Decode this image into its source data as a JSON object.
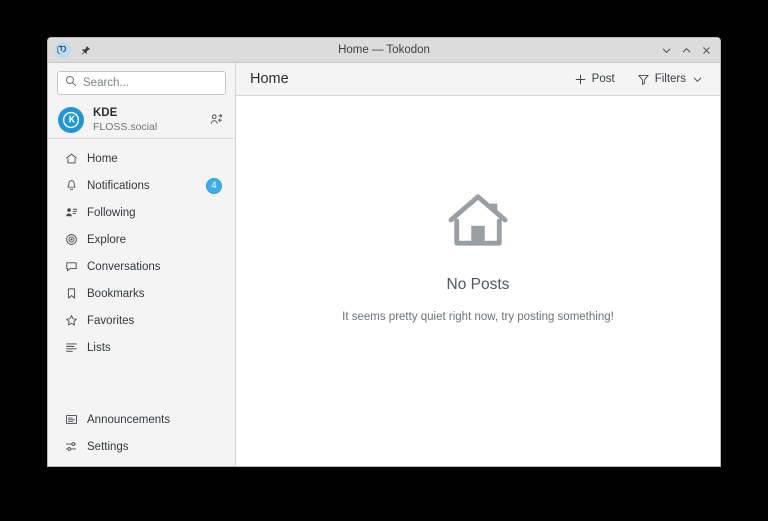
{
  "window": {
    "title": "Home — Tokodon",
    "app_icon": "mastodon-icon",
    "pin_icon": "pin-icon",
    "controls": [
      {
        "name": "minimize-button",
        "icon": "chevron-down-icon"
      },
      {
        "name": "maximize-button",
        "icon": "chevron-up-icon"
      },
      {
        "name": "close-button",
        "icon": "close-icon"
      }
    ]
  },
  "sidebar": {
    "search": {
      "placeholder": "Search...",
      "value": "",
      "icon": "search-icon"
    },
    "account": {
      "display_name": "KDE",
      "instance": "FLOSS.social",
      "avatar_letter": "K",
      "avatar_icon": "kde-logo-icon",
      "switch_icon": "switch-user-icon"
    },
    "items": [
      {
        "label": "Home",
        "icon": "home-icon",
        "badge": ""
      },
      {
        "label": "Notifications",
        "icon": "bell-icon",
        "badge": "4"
      },
      {
        "label": "Following",
        "icon": "person-list-icon",
        "badge": ""
      },
      {
        "label": "Explore",
        "icon": "compass-icon",
        "badge": ""
      },
      {
        "label": "Conversations",
        "icon": "speech-bubble-icon",
        "badge": ""
      },
      {
        "label": "Bookmarks",
        "icon": "bookmark-icon",
        "badge": ""
      },
      {
        "label": "Favorites",
        "icon": "star-icon",
        "badge": ""
      },
      {
        "label": "Lists",
        "icon": "list-icon",
        "badge": ""
      }
    ],
    "bottom_items": [
      {
        "label": "Announcements",
        "icon": "announcement-icon"
      },
      {
        "label": "Settings",
        "icon": "sliders-icon"
      }
    ]
  },
  "main": {
    "page_title": "Home",
    "post_button": {
      "label": "Post",
      "icon": "plus-icon"
    },
    "filters_button": {
      "label": "Filters",
      "icon": "funnel-icon",
      "chevron": "chevron-down-icon"
    },
    "empty_state": {
      "icon": "house-icon",
      "title": "No Posts",
      "subtitle": "It seems pretty quiet right now, try posting something!"
    }
  },
  "colors": {
    "accent": "#3daee9",
    "sidebar_bg": "#f4f4f4",
    "content_bg": "#ffffff",
    "titlebar_bg": "#dcdcdc",
    "text": "#33383c",
    "muted_text": "#6d7276",
    "empty_icon": "#9a9fa3"
  }
}
